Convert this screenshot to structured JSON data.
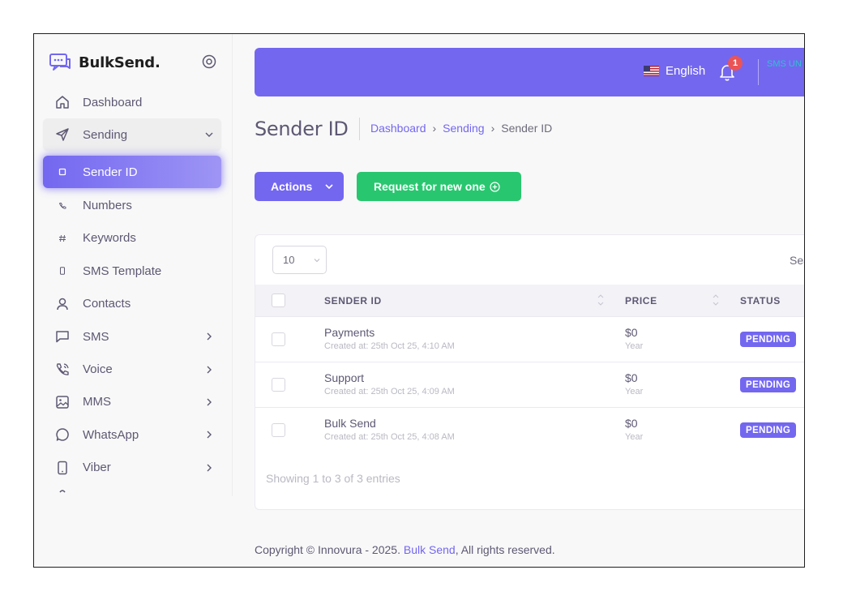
{
  "brand": {
    "name": "BulkSend."
  },
  "sidebar": {
    "items": [
      {
        "label": "Dashboard",
        "icon": "home-icon"
      },
      {
        "label": "Sending",
        "icon": "send-icon"
      },
      {
        "label": "Sender ID",
        "icon": "square-small-icon"
      },
      {
        "label": "Numbers",
        "icon": "phone-small-icon"
      },
      {
        "label": "Keywords",
        "icon": "hash-icon"
      },
      {
        "label": "SMS Template",
        "icon": "mobile-small-icon"
      },
      {
        "label": "Contacts",
        "icon": "user-icon"
      },
      {
        "label": "SMS",
        "icon": "message-square-icon"
      },
      {
        "label": "Voice",
        "icon": "phone-call-icon"
      },
      {
        "label": "MMS",
        "icon": "image-icon"
      },
      {
        "label": "WhatsApp",
        "icon": "message-circle-icon"
      },
      {
        "label": "Viber",
        "icon": "smartphone-icon"
      }
    ]
  },
  "navbar": {
    "language": "English",
    "notification_count": "1",
    "user_text": "SMS UN",
    "accent": "#7367f0"
  },
  "page": {
    "title": "Sender ID",
    "breadcrumb": [
      "Dashboard",
      "Sending",
      "Sender ID"
    ]
  },
  "toolbar": {
    "actions_label": "Actions",
    "request_label": "Request for new one"
  },
  "table": {
    "page_length": "10",
    "search_label": "Sea",
    "columns": [
      "SENDER ID",
      "PRICE",
      "STATUS"
    ],
    "rows": [
      {
        "name": "Payments",
        "created": "Created at: 25th Oct 25, 4:10 AM",
        "price": "$0",
        "period": "Year",
        "status": "PENDING"
      },
      {
        "name": "Support",
        "created": "Created at: 25th Oct 25, 4:09 AM",
        "price": "$0",
        "period": "Year",
        "status": "PENDING"
      },
      {
        "name": "Bulk Send",
        "created": "Created at: 25th Oct 25, 4:08 AM",
        "price": "$0",
        "period": "Year",
        "status": "PENDING"
      }
    ],
    "info": "Showing 1 to 3 of 3 entries"
  },
  "footer": {
    "prefix": "Copyright © Innovura - 2025.",
    "link": "Bulk Send",
    "suffix": ", All rights reserved."
  }
}
